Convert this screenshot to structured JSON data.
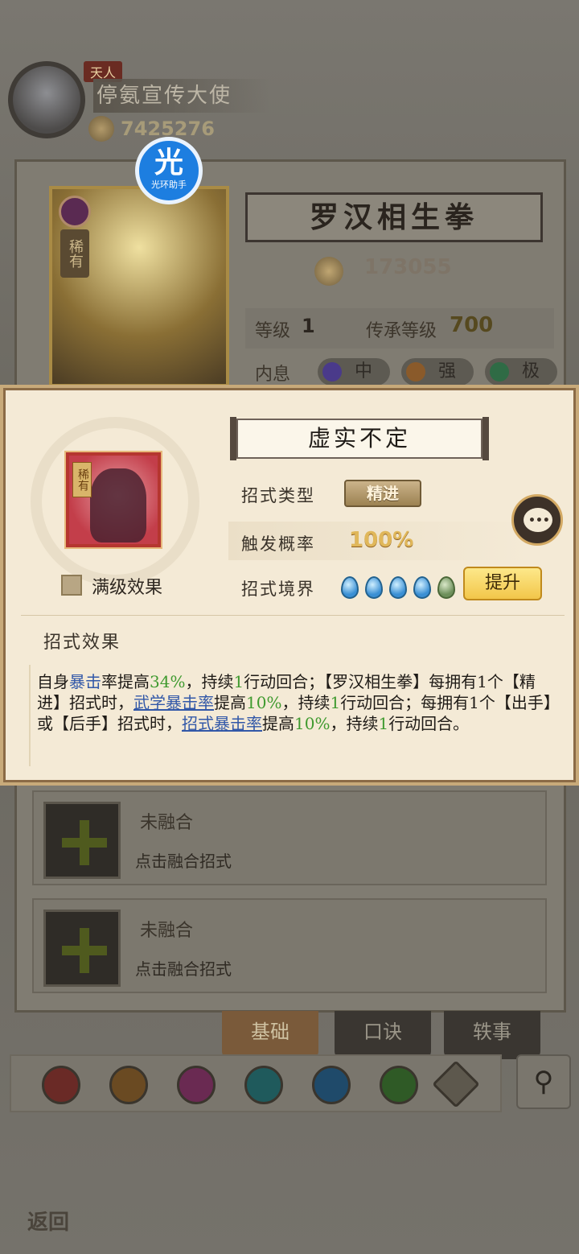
{
  "player": {
    "rank_tag": "天人",
    "name": "停氨宣传大使",
    "power": "7425276"
  },
  "helper_badge": {
    "char": "光",
    "label": "光环助手"
  },
  "skill_detail": {
    "title": "罗汉相生拳",
    "power": "173055",
    "card_rarity": "稀有",
    "level_label": "等级",
    "level_value": "1",
    "inherit_label": "传承等级",
    "inherit_value": "700",
    "neixi_label": "内息",
    "neixi": [
      {
        "label": "中",
        "color": "#4a3a8a"
      },
      {
        "label": "强",
        "color": "#8a5a2a"
      },
      {
        "label": "极",
        "color": "#2f6b45"
      }
    ]
  },
  "popup": {
    "move_name": "虚实不定",
    "rarity": "稀有",
    "maxlevel_label": "满级效果",
    "type_label": "招式类型",
    "type_value": "精进",
    "prob_label": "触发概率",
    "prob_value": "100%",
    "realm_label": "招式境界",
    "realm_filled": 4,
    "realm_total": 5,
    "upgrade_button": "提升",
    "effect_title": "招式效果",
    "effect": {
      "s1": "自身",
      "s2": "暴击",
      "s3": "率提高",
      "s4": "34%",
      "s5": "，持续",
      "s6": "1",
      "s7": "行动回合；【罗汉相生拳】每拥有1个【精进】招式时，",
      "s8": "武学暴击率",
      "s9": "提高",
      "s10": "10%",
      "s11": "，持续",
      "s12": "1",
      "s13": "行动回合；每拥有1个【出手】或【后手】招式时，",
      "s14": "招式暴击率",
      "s15": "提高",
      "s16": "10%",
      "s17": "，持续",
      "s18": "1",
      "s19": "行动回合。"
    }
  },
  "fusion": [
    {
      "title": "未融合",
      "sub": "点击融合招式"
    },
    {
      "title": "未融合",
      "sub": "点击融合招式"
    }
  ],
  "tabs": [
    "基础",
    "口诀",
    "轶事"
  ],
  "filter_icons": [
    "sword-filter-icon",
    "blade-filter-icon",
    "fist-filter-icon",
    "palm-filter-icon",
    "taiji-filter-icon",
    "dart-filter-icon",
    "other-filter-icon"
  ],
  "back_label": "返回",
  "search_icon": "search-icon"
}
